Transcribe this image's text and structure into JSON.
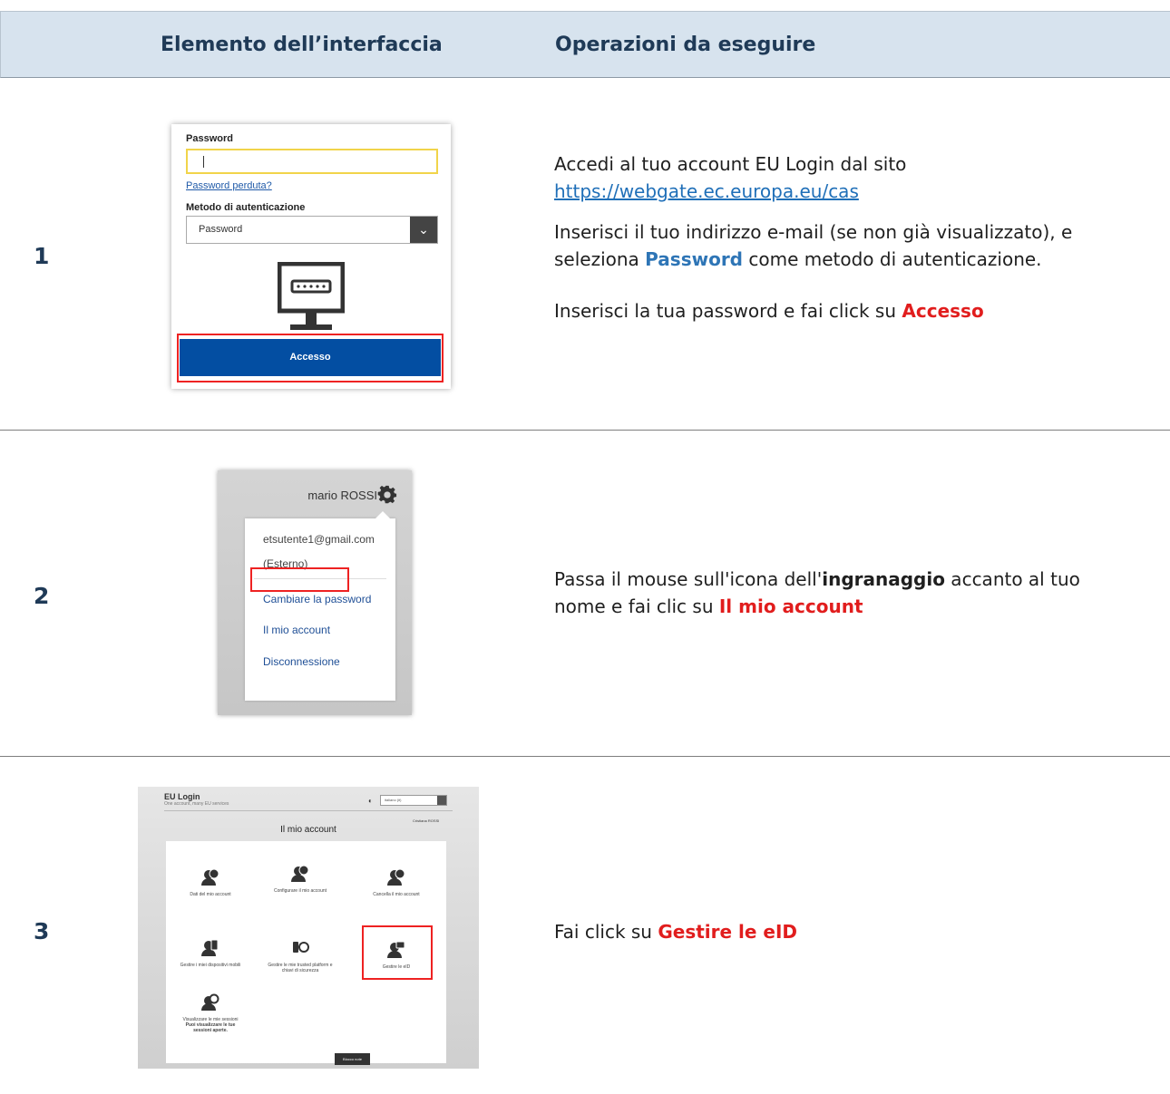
{
  "header": {
    "col1": "Elemento dell’interfaccia",
    "col2": "Operazioni da eseguire"
  },
  "steps": [
    {
      "number": "1",
      "text_a": "Accedi al tuo account EU Login dal sito",
      "link": "https://webgate.ec.europa.eu/cas",
      "text_b_1": "Inserisci il tuo indirizzo e-mail (se non già visualizzato), e",
      "text_b_2a": "seleziona ",
      "text_b_bold": "Password",
      "text_b_2b": " come metodo di autenticazione.",
      "text_c": "Inserisci la tua password e fai click su ",
      "text_c_bold": "Accesso"
    },
    {
      "number": "2",
      "text_a": "Passa il mouse sull'icona dell'",
      "text_a_bold": "ingranaggio",
      "text_a_end": " accanto al tuo",
      "text_b": "nome e fai clic su ",
      "text_b_bold": "Il mio account"
    },
    {
      "number": "3",
      "text_a": "Fai click su ",
      "text_a_bold": "Gestire le eID"
    }
  ],
  "shot1": {
    "password_label": "Password",
    "password_value": "",
    "lost_password": "Password perduta?",
    "method_label": "Metodo di autenticazione",
    "method_value": "Password",
    "submit": "Accesso"
  },
  "shot2": {
    "user_name": "mario ROSSI",
    "email": "etsutente1@gmail.com",
    "account_type": "(Esterno)",
    "menu": [
      "Cambiare la password",
      "Il mio account",
      "Disconnessione"
    ]
  },
  "shot3": {
    "brand": "EU Login",
    "tagline": "One account, many EU services",
    "language": "italiano (it)",
    "user": "Cristiana ROSSI",
    "title": "Il mio account",
    "tiles": [
      "Dati del mio account",
      "Configurare il mio account",
      "Cancella il mio account",
      "Gestire i miei dispositivi mobili",
      "Gestire le mie trusted platform e chiavi di sicurezza",
      "Gestire le eID",
      "Visualizzare le mie sessioni"
    ],
    "sessions_note": "Puoi visualizzare le tue sessioni aperte.",
    "blocco": "Blocco note"
  },
  "colors": {
    "header_bg": "#d7e3ee",
    "header_text": "#1f3a57",
    "highlight_red": "#e11d1d",
    "highlight_blue": "#2e75b6",
    "eu_button": "#034ea2"
  },
  "icons": [
    "monitor-password-icon",
    "gear-icon",
    "user-icon"
  ]
}
